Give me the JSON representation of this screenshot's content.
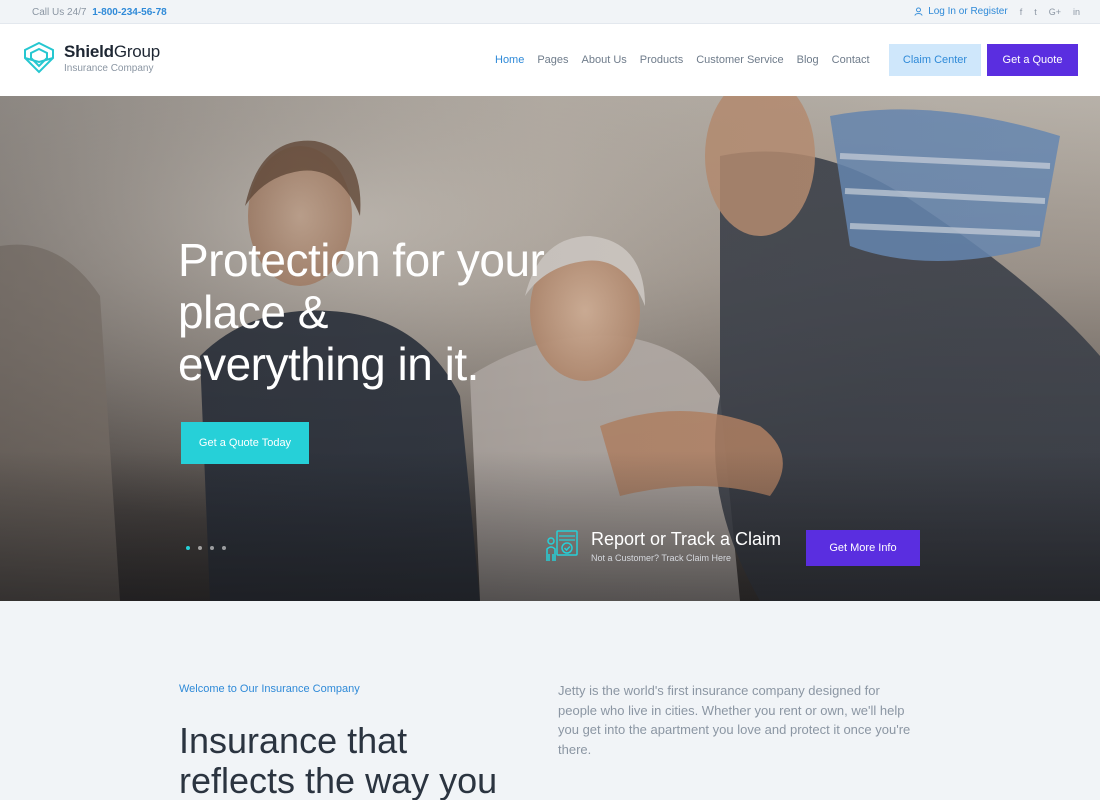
{
  "topbar": {
    "call_label": "Call Us 24/7",
    "phone": "1-800-234-56-78",
    "login": "Log In or Register",
    "social": [
      "f",
      "t",
      "G+",
      "in"
    ]
  },
  "header": {
    "brand_main": "Shield",
    "brand_accent": "Group",
    "brand_sub": "Insurance Company",
    "nav": [
      "Home",
      "Pages",
      "About Us",
      "Products",
      "Customer Service",
      "Blog",
      "Contact"
    ],
    "active_nav": "Home",
    "claim_button": "Claim Center",
    "quote_button": "Get a Quote"
  },
  "hero": {
    "title_line1": "Protection for your",
    "title_line2": "place &",
    "title_line3": "everything in it.",
    "cta": "Get a Quote Today",
    "slides": 4,
    "active_slide": 1,
    "claim_title": "Report  or Track a Claim",
    "claim_sub": "Not a Customer? Track Claim Here",
    "more_button": "Get More Info"
  },
  "welcome": {
    "eyebrow": "Welcome to Our Insurance Company",
    "heading_line1": "Insurance that",
    "heading_line2": "reflects the way you",
    "description": "Jetty is the world's first insurance company designed for people who live in cities. Whether you rent or own, we'll help you get into the apartment you love and protect it once you're there."
  },
  "colors": {
    "accent_blue": "#2f8ad8",
    "purple": "#5a2ee0",
    "teal": "#26d0d8",
    "light_blue": "#cfe7fb"
  }
}
